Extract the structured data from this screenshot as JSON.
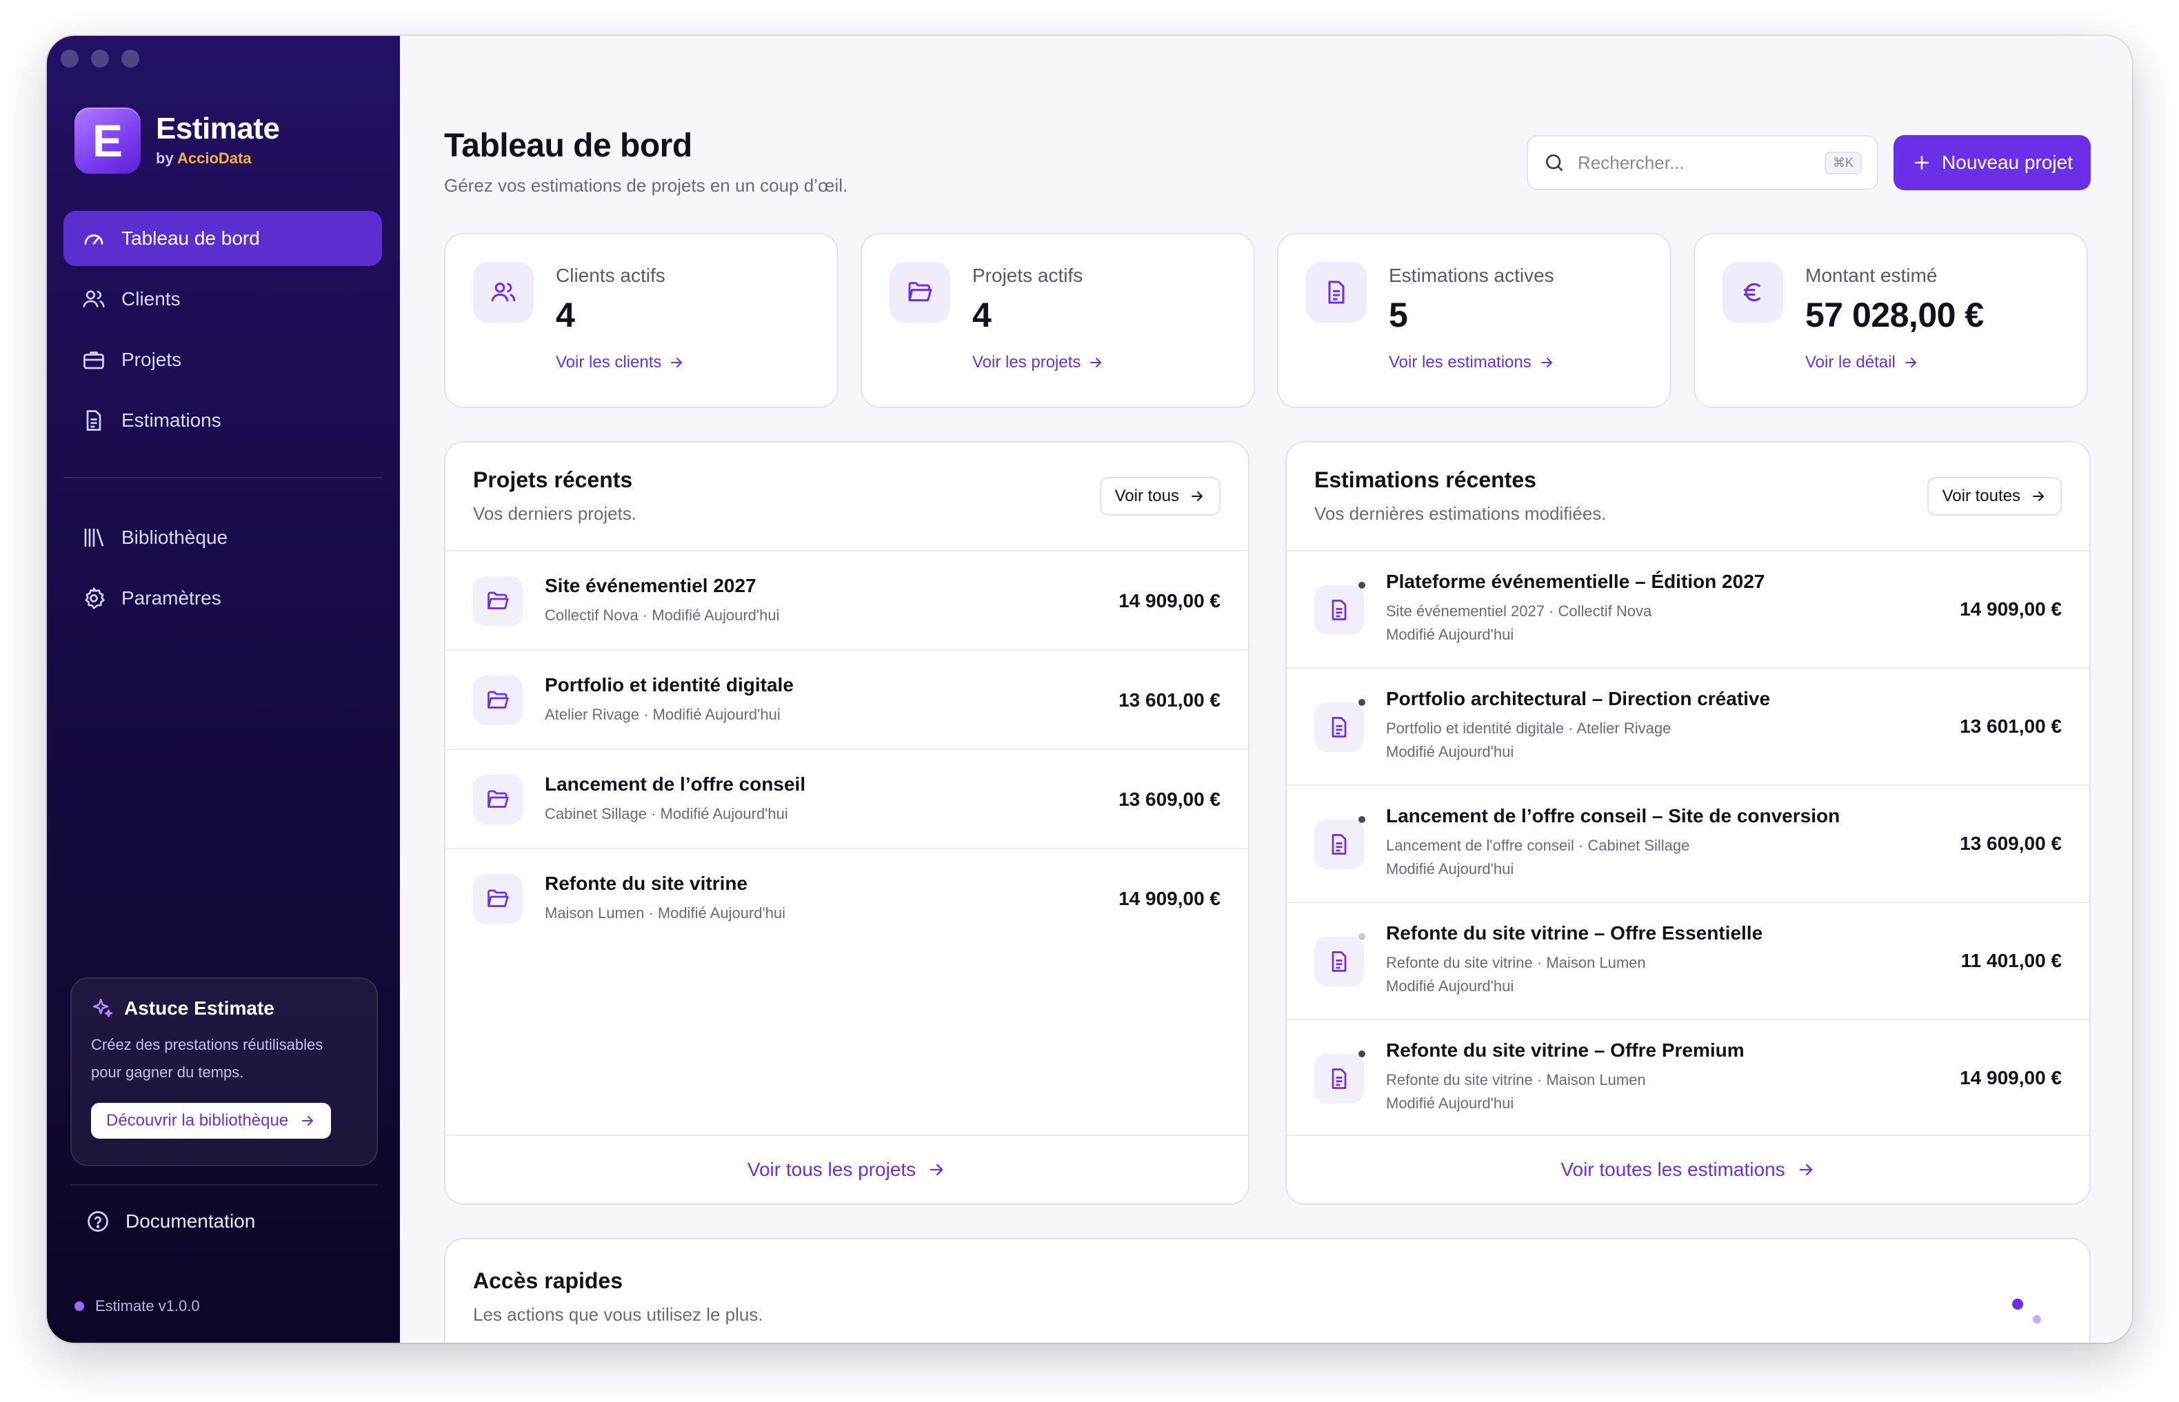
{
  "app": {
    "name": "Estimate",
    "by_prefix": "by ",
    "by_brand": "AccioData",
    "logo_letter": "E",
    "version": "Estimate v1.0.0"
  },
  "colors": {
    "accent": "#6a2fe6",
    "sidebar_top": "#231063",
    "sidebar_bottom": "#0d0626",
    "warning": "#f2b23b"
  },
  "sidebar": {
    "items": [
      {
        "label": "Tableau de bord",
        "icon": "gauge-icon",
        "active": true
      },
      {
        "label": "Clients",
        "icon": "users-icon"
      },
      {
        "label": "Projets",
        "icon": "briefcase-icon"
      },
      {
        "label": "Estimations",
        "icon": "document-icon"
      },
      {
        "label": "Bibliothèque",
        "icon": "library-icon"
      },
      {
        "label": "Paramètres",
        "icon": "gear-icon"
      }
    ],
    "tip": {
      "title": "Astuce Estimate",
      "text": "Créez des prestations réutilisables pour gagner du temps.",
      "button": "Découvrir la bibliothèque"
    },
    "documentation": "Documentation"
  },
  "header": {
    "title": "Tableau de bord",
    "subtitle": "Gérez vos estimations de projets en un coup d’œil.",
    "search_placeholder": "Rechercher...",
    "search_shortcut": "⌘K",
    "new_project": "Nouveau projet"
  },
  "stats": [
    {
      "label": "Clients actifs",
      "value": "4",
      "link": "Voir les clients",
      "icon": "users-icon"
    },
    {
      "label": "Projets actifs",
      "value": "4",
      "link": "Voir les projets",
      "icon": "folder-icon"
    },
    {
      "label": "Estimations actives",
      "value": "5",
      "link": "Voir les estimations",
      "icon": "document-icon"
    },
    {
      "label": "Montant estimé",
      "value": "57 028,00 €",
      "link": "Voir le détail",
      "icon": "euro-icon"
    }
  ],
  "recent_projects": {
    "title": "Projets récents",
    "subtitle": "Vos derniers projets.",
    "button": "Voir tous",
    "footer": "Voir tous les projets",
    "items": [
      {
        "name": "Site événementiel 2027",
        "meta": "Collectif Nova · Modifié Aujourd'hui",
        "amount": "14 909,00 €"
      },
      {
        "name": "Portfolio et identité digitale",
        "meta": "Atelier Rivage · Modifié Aujourd'hui",
        "amount": "13 601,00 €"
      },
      {
        "name": "Lancement de l’offre conseil",
        "meta": "Cabinet Sillage · Modifié Aujourd'hui",
        "amount": "13 609,00 €"
      },
      {
        "name": "Refonte du site vitrine",
        "meta": "Maison Lumen · Modifié Aujourd'hui",
        "amount": "14 909,00 €"
      }
    ]
  },
  "recent_estimates": {
    "title": "Estimations récentes",
    "subtitle": "Vos dernières estimations modifiées.",
    "button": "Voir toutes",
    "footer": "Voir toutes les estimations",
    "items": [
      {
        "name": "Plateforme événementielle – Édition 2027",
        "meta": "Site événementiel 2027 · Collectif Nova",
        "modified": "Modifié Aujourd'hui",
        "amount": "14 909,00 €"
      },
      {
        "name": "Portfolio architectural – Direction créative",
        "meta": "Portfolio et identité digitale · Atelier Rivage",
        "modified": "Modifié Aujourd'hui",
        "amount": "13 601,00 €"
      },
      {
        "name": "Lancement de l’offre conseil – Site de conversion",
        "meta": "Lancement de l'offre conseil · Cabinet Sillage",
        "modified": "Modifié Aujourd'hui",
        "amount": "13 609,00 €"
      },
      {
        "name": "Refonte du site vitrine – Offre Essentielle",
        "meta": "Refonte du site vitrine · Maison Lumen",
        "modified": "Modifié Aujourd'hui",
        "amount": "11 401,00 €"
      },
      {
        "name": "Refonte du site vitrine – Offre Premium",
        "meta": "Refonte du site vitrine · Maison Lumen",
        "modified": "Modifié Aujourd'hui",
        "amount": "14 909,00 €"
      }
    ]
  },
  "quick_access": {
    "title": "Accès rapides",
    "subtitle": "Les actions que vous utilisez le plus."
  }
}
